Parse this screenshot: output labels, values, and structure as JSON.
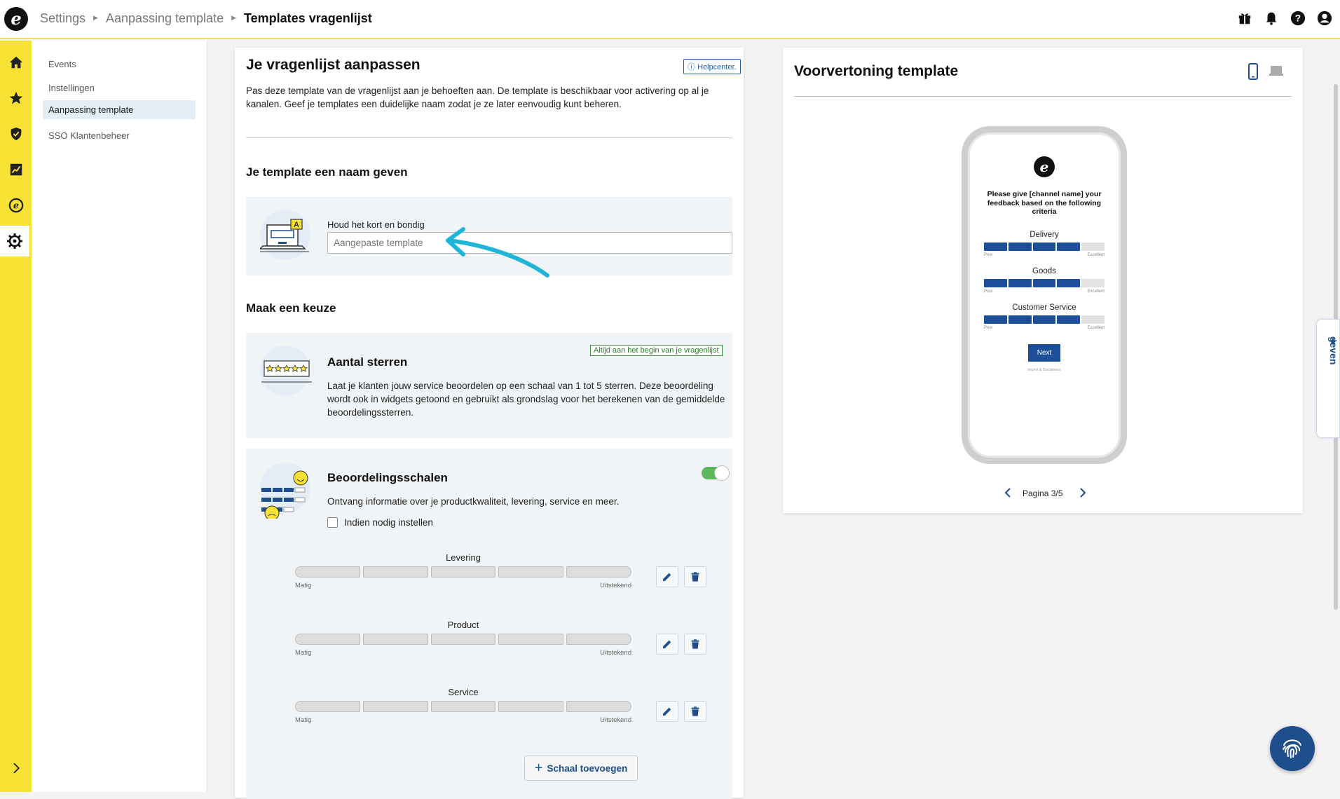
{
  "breadcrumb": {
    "items": [
      "Settings",
      "Aanpassing template"
    ],
    "current": "Templates vragenlijst"
  },
  "subnav": {
    "items": [
      "Events",
      "Instellingen",
      "Aanpassing template",
      "SSO Klantenbeheer"
    ],
    "active_index": 2
  },
  "main": {
    "title": "Je vragenlijst aanpassen",
    "help_label": "Helpcenter.",
    "intro": "Pas deze template van de vragenlijst aan je behoeften aan. De template is beschikbaar voor activering op al je kanalen. Geef je templates een duidelijke naam zodat je ze later eenvoudig kunt beheren.",
    "name_section": {
      "heading": "Je template een naam geven",
      "field_label": "Houd het kort en bondig",
      "placeholder": "Aangepaste template",
      "value": ""
    },
    "choice_heading": "Maak een keuze",
    "stars": {
      "title": "Aantal sterren",
      "tag": "Altijd aan het begin van je vragenlijst",
      "description": "Laat je klanten jouw service beoordelen op een schaal van 1 tot 5 sterren. Deze beoordeling wordt ook in widgets getoond en gebruikt als grondslag voor het berekenen van de gemiddelde beoordelingssterren."
    },
    "scales": {
      "title": "Beoordelingsschalen",
      "description": "Ontvang informatie over je productkwaliteit, levering, service en meer.",
      "toggle_on": true,
      "checkbox_label": "Indien nodig instellen",
      "checkbox_checked": false,
      "items": [
        {
          "label": "Levering",
          "low": "Matig",
          "high": "Uitstekend"
        },
        {
          "label": "Product",
          "low": "Matig",
          "high": "Uitstekend"
        },
        {
          "label": "Service",
          "low": "Matig",
          "high": "Uitstekend"
        }
      ],
      "add_label": "Schaal toevoegen"
    }
  },
  "preview": {
    "title": "Voorvertoning template",
    "phone": {
      "question": "Please give [channel name] your feedback based on the following criteria",
      "scales": [
        {
          "label": "Delivery",
          "low": "Poor",
          "high": "Excellent",
          "filled": 4,
          "total": 5
        },
        {
          "label": "Goods",
          "low": "Poor",
          "high": "Excellent",
          "filled": 4,
          "total": 5
        },
        {
          "label": "Customer Service",
          "low": "Poor",
          "high": "Excellent",
          "filled": 4,
          "total": 5
        }
      ],
      "next_label": "Next",
      "footer": "Imprint & Disclaimers"
    },
    "pagination": "Pagina 3/5"
  },
  "feedback_tab": "Feedback geven",
  "colors": {
    "accent": "#1f4e8c",
    "rail": "#f7e234",
    "toggle": "#5cb85c"
  },
  "icons": [
    "gift-icon",
    "bell-icon",
    "help-icon",
    "account-icon",
    "home-icon",
    "star-icon",
    "shield-icon",
    "chart-icon",
    "ekomi-icon",
    "gear-icon",
    "chevron-right-icon",
    "mobile-icon",
    "desktop-icon",
    "edit-icon",
    "trash-icon",
    "fingerprint-icon"
  ]
}
